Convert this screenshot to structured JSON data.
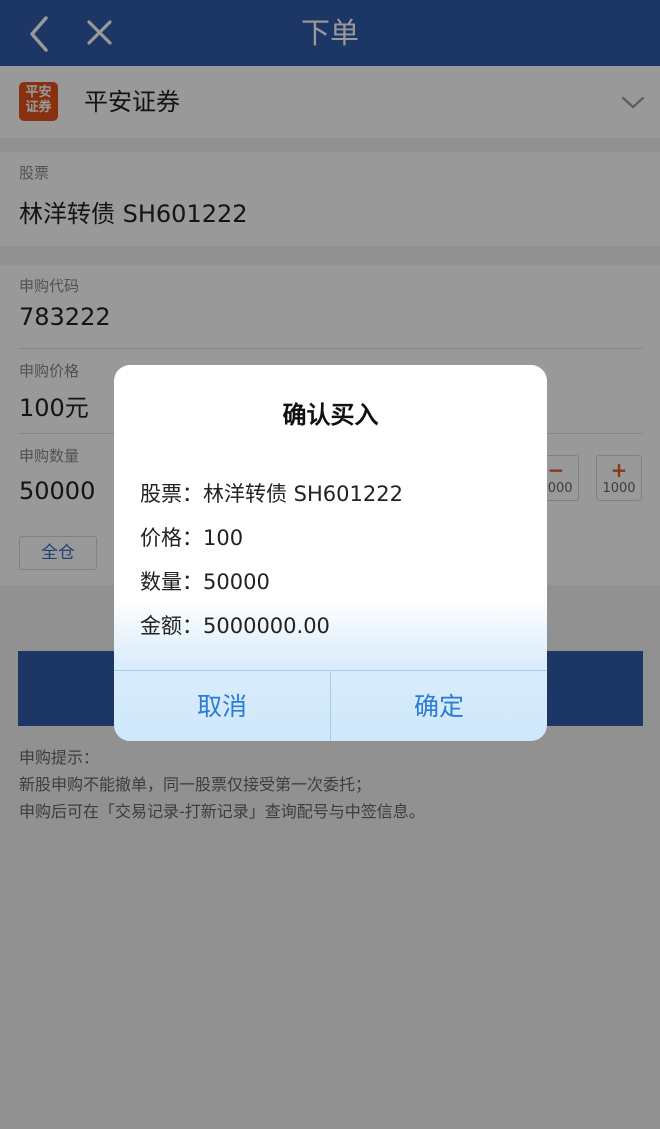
{
  "nav": {
    "title": "下单"
  },
  "broker": {
    "logo_text_line1": "平安",
    "logo_text_line2": "证券",
    "name": "平安证券"
  },
  "stock": {
    "label": "股票",
    "value": "林洋转债 SH601222"
  },
  "form": {
    "code_label": "申购代码",
    "code_value": "783222",
    "price_label": "申购价格",
    "price_value": "100元",
    "qty_label": "申购数量",
    "qty_value": "50000",
    "minus_amount": "1000",
    "plus_amount": "1000",
    "all_button": "全仓"
  },
  "notes": {
    "title": "申购提示：",
    "line1": "新股申购不能撤单，同一股票仅接受第一次委托；",
    "line2": "申购后可在「交易记录-打新记录」查询配号与中签信息。"
  },
  "dialog": {
    "title": "确认买入",
    "stock_row": "股票：林洋转债 SH601222",
    "price_row": "价格：100",
    "qty_row": "数量：50000",
    "amount_row": "金额：5000000.00",
    "cancel": "取消",
    "confirm": "确定"
  }
}
